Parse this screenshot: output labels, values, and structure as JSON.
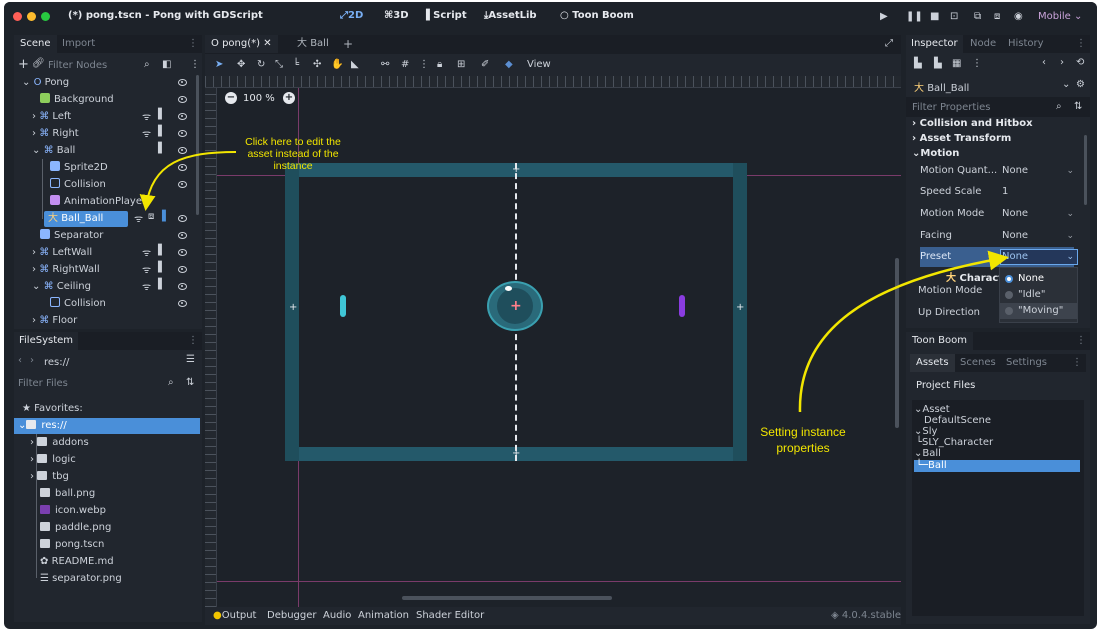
{
  "window": {
    "title": "(*) pong.tscn - Pong with GDScript"
  },
  "workspaces": [
    "2D",
    "3D",
    "Script",
    "AssetLib",
    "Toon Boom"
  ],
  "renderer": "Mobile",
  "colors": {
    "accent": "#4a8fd9",
    "annotation": "#f2e600",
    "panel": "#21262e"
  },
  "scene_dock": {
    "tabs": [
      "Scene",
      "Import"
    ],
    "filter_placeholder": "Filter Nodes",
    "nodes": [
      {
        "label": "Pong",
        "icon": "node2d-icon"
      },
      {
        "label": "Background",
        "icon": "colorrect-icon"
      },
      {
        "label": "Left",
        "icon": "characterbody-icon"
      },
      {
        "label": "Right",
        "icon": "characterbody-icon"
      },
      {
        "label": "Ball",
        "icon": "characterbody-icon"
      },
      {
        "label": "Sprite2D",
        "icon": "sprite-icon"
      },
      {
        "label": "Collision",
        "icon": "collision-icon"
      },
      {
        "label": "AnimationPlayer",
        "icon": "animationplayer-icon"
      },
      {
        "label": "Ball_Ball",
        "icon": "toonboom-icon"
      },
      {
        "label": "Separator",
        "icon": "sprite-icon"
      },
      {
        "label": "LeftWall",
        "icon": "area-icon"
      },
      {
        "label": "RightWall",
        "icon": "area-icon"
      },
      {
        "label": "Ceiling",
        "icon": "area-icon"
      },
      {
        "label": "Collision",
        "icon": "collision-icon"
      },
      {
        "label": "Floor",
        "icon": "area-icon"
      }
    ]
  },
  "filesystem_dock": {
    "title": "FileSystem",
    "path": "res://",
    "filter_placeholder": "Filter Files",
    "items": [
      {
        "label": "Favorites:",
        "icon": "star-icon"
      },
      {
        "label": "res://",
        "icon": "folder-icon"
      },
      {
        "label": "addons",
        "icon": "folder-icon"
      },
      {
        "label": "logic",
        "icon": "folder-icon"
      },
      {
        "label": "tbg",
        "icon": "folder-icon"
      },
      {
        "label": "ball.png",
        "icon": "image-file-icon"
      },
      {
        "label": "icon.webp",
        "icon": "image-file-icon"
      },
      {
        "label": "paddle.png",
        "icon": "image-file-icon"
      },
      {
        "label": "pong.tscn",
        "icon": "scene-file-icon"
      },
      {
        "label": "README.md",
        "icon": "text-file-icon"
      },
      {
        "label": "separator.png",
        "icon": "image-file-icon"
      }
    ]
  },
  "editor": {
    "tabs": [
      "pong(*)",
      "Ball"
    ],
    "toolbar_view": "View",
    "zoom": "100 %"
  },
  "bottom_panel": {
    "tabs": [
      "Output",
      "Debugger",
      "Audio",
      "Animation",
      "Shader Editor"
    ],
    "version": "4.0.4.stable"
  },
  "inspector": {
    "tabs": [
      "Inspector",
      "Node",
      "History"
    ],
    "object": "Ball_Ball",
    "filter_placeholder": "Filter Properties",
    "sections": [
      "Collision and Hitbox",
      "Asset Transform",
      "Motion"
    ],
    "properties": [
      {
        "key": "Motion Quant...",
        "value": "None"
      },
      {
        "key": "Speed Scale",
        "value": "1"
      },
      {
        "key": "Motion Mode",
        "value": "None"
      },
      {
        "key": "Facing",
        "value": "None"
      },
      {
        "key": "Preset",
        "value": "None"
      }
    ],
    "sub_section": "Characte",
    "lower_rows": [
      "Motion Mode",
      "Up Direction"
    ],
    "preset_options": [
      "None",
      "\"Idle\"",
      "\"Moving\""
    ]
  },
  "toon_boom_dock": {
    "title": "Toon Boom",
    "tabs": [
      "Assets",
      "Scenes",
      "Settings"
    ],
    "heading": "Project Files",
    "tree": [
      "Asset",
      "DefaultScene",
      "Sly",
      "SLY_Character",
      "Ball",
      "Ball"
    ]
  },
  "annotations": {
    "edit_asset": "Click here to edit the asset instead of the instance",
    "instance_props": "Setting instance properties"
  }
}
